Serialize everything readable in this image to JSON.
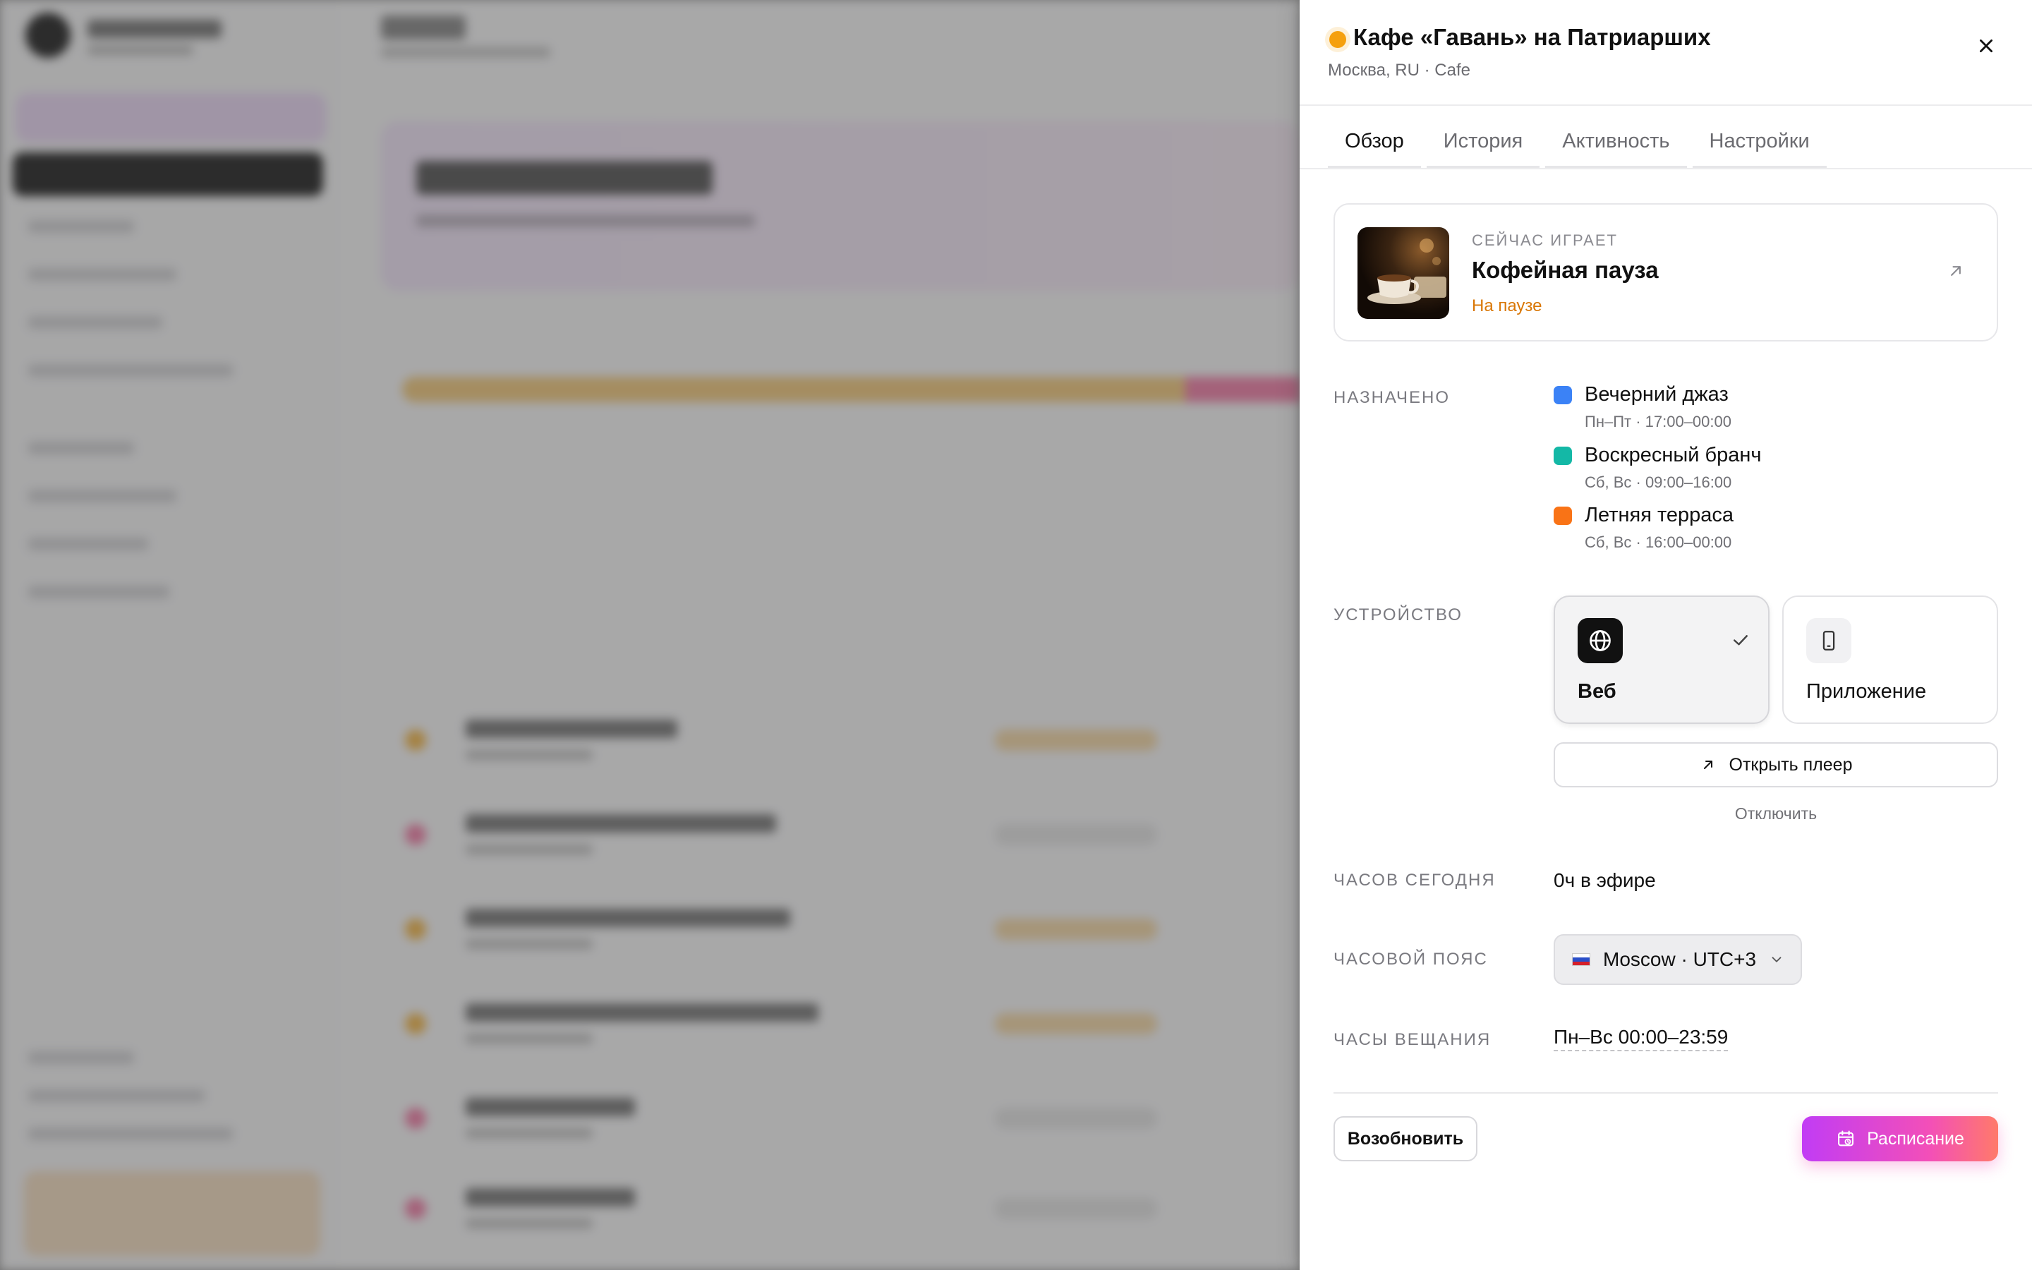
{
  "drawer": {
    "title": "Кафе «Гавань» на Патриарших",
    "subtitle": "Москва, RU · Cafe",
    "status_color": "#f5a00f"
  },
  "tabs": [
    {
      "label": "Обзор",
      "active": true
    },
    {
      "label": "История",
      "active": false
    },
    {
      "label": "Активность",
      "active": false
    },
    {
      "label": "Настройки",
      "active": false
    }
  ],
  "now_playing": {
    "label": "СЕЙЧАС ИГРАЕТ",
    "track": "Кофейная пауза",
    "status": "На паузе",
    "cover_icon": "coffee-cup-image"
  },
  "assigned": {
    "label": "НАЗНАЧЕНО",
    "items": [
      {
        "name": "Вечерний джаз",
        "time": "Пн–Пт · 17:00–00:00",
        "color": "#3b82f6"
      },
      {
        "name": "Воскресный бранч",
        "time": "Сб, Вс · 09:00–16:00",
        "color": "#14b8a6"
      },
      {
        "name": "Летняя терраса",
        "time": "Сб, Вс · 16:00–00:00",
        "color": "#f97316"
      }
    ]
  },
  "device": {
    "label": "УСТРОЙСТВО",
    "options": [
      {
        "name": "Веб",
        "icon": "globe-icon",
        "selected": true
      },
      {
        "name": "Приложение",
        "icon": "phone-icon",
        "selected": false
      }
    ],
    "open_player": "Открыть плеер",
    "disconnect": "Отключить"
  },
  "hours_today": {
    "label": "ЧАСОВ СЕГОДНЯ",
    "value": "0ч в эфире"
  },
  "timezone": {
    "label": "ЧАСОВОЙ ПОЯС",
    "value": "Moscow · UTC+3"
  },
  "broadcast_hours": {
    "label": "ЧАСЫ ВЕЩАНИЯ",
    "value": "Пн–Вс 00:00–23:59"
  },
  "footer": {
    "resume": "Возобновить",
    "schedule": "Расписание"
  },
  "accent": "#e040b0"
}
